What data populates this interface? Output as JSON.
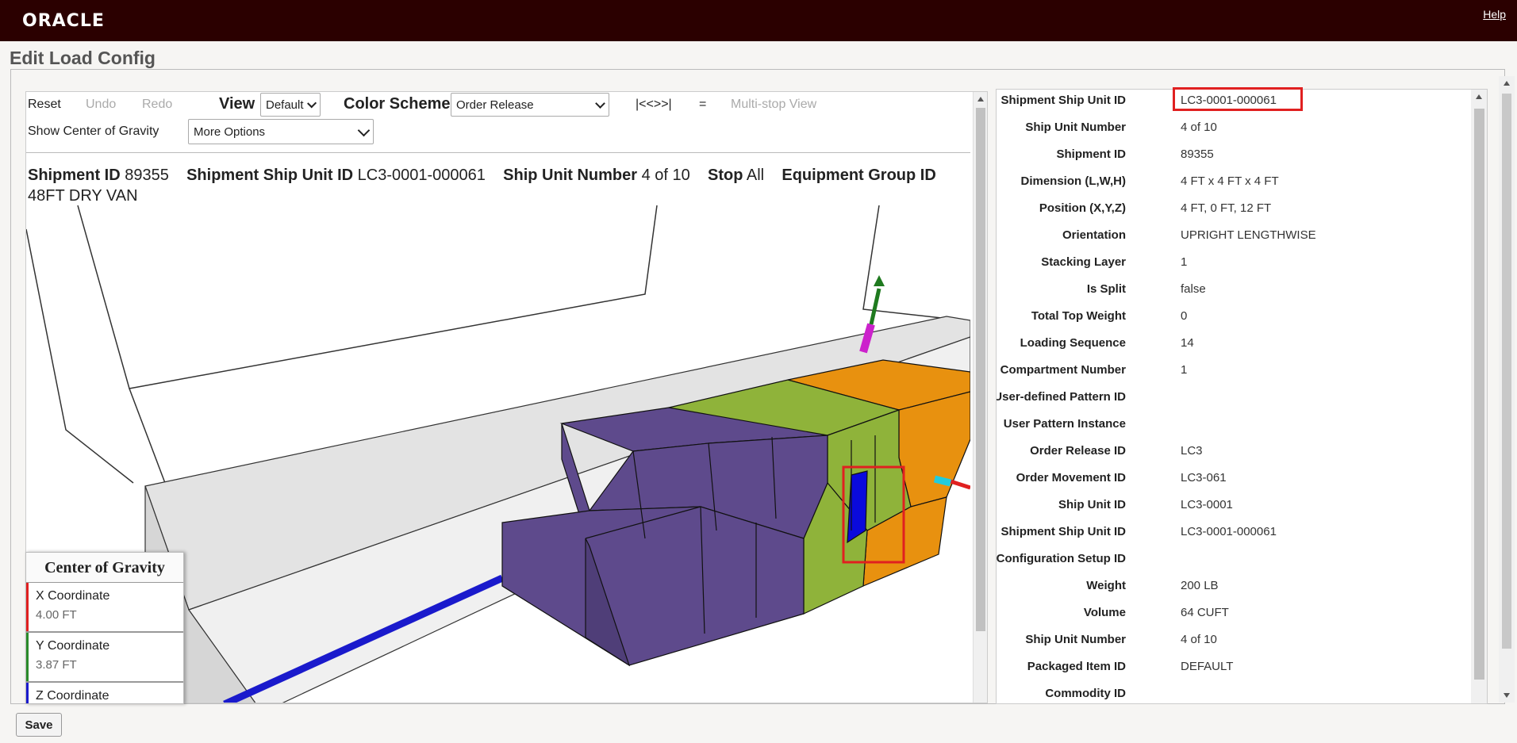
{
  "header": {
    "logo_text": "ORACLE",
    "help_label": "Help"
  },
  "page": {
    "title": "Edit Load Config"
  },
  "toolbar": {
    "reset_label": "Reset",
    "undo_label": "Undo",
    "redo_label": "Redo",
    "view_label": "View",
    "view_value": "Default",
    "color_scheme_label": "Color Scheme",
    "color_scheme_value": "Order Release",
    "nav_label": "|<<>>|",
    "equals_label": "=",
    "multistop_label": "Multi-stop View",
    "show_cog_label": "Show Center of Gravity",
    "more_options_label": "More Options"
  },
  "info": {
    "shipment_id_label": "Shipment ID",
    "shipment_id": "89355",
    "ssu_id_label": "Shipment Ship Unit ID",
    "ssu_id": "LC3-0001-000061",
    "ship_unit_number_label": "Ship Unit Number",
    "ship_unit_number": "4 of 10",
    "stop_label": "Stop",
    "stop": "All",
    "equipment_group_label": "Equipment Group ID",
    "equipment_group": "48FT DRY VAN"
  },
  "center_of_gravity": {
    "title": "Center of Gravity",
    "items": [
      {
        "label": "X Coordinate",
        "value": "4.00 FT",
        "color": "#e02020"
      },
      {
        "label": "Y Coordinate",
        "value": "3.87 FT",
        "color": "#2a8a2a"
      },
      {
        "label": "Z Coordinate",
        "value": "",
        "color": "#1a1acc"
      }
    ]
  },
  "scene": {
    "colors": {
      "purple": "#5e4a8c",
      "green": "#8fb33a",
      "orange": "#e8910f",
      "blue": "#0a0adc",
      "highlight": "#e02020"
    }
  },
  "properties": [
    {
      "key": "Shipment Ship Unit ID",
      "value": "LC3-0001-000061"
    },
    {
      "key": "Ship Unit Number",
      "value": "4 of 10"
    },
    {
      "key": "Shipment ID",
      "value": "89355"
    },
    {
      "key": "Dimension (L,W,H)",
      "value": "4 FT x 4 FT x 4 FT"
    },
    {
      "key": "Position (X,Y,Z)",
      "value": "4 FT, 0 FT, 12 FT"
    },
    {
      "key": "Orientation",
      "value": "UPRIGHT LENGTHWISE"
    },
    {
      "key": "Stacking Layer",
      "value": "1"
    },
    {
      "key": "Is Split",
      "value": "false"
    },
    {
      "key": "Total Top Weight",
      "value": "0"
    },
    {
      "key": "Loading Sequence",
      "value": "14"
    },
    {
      "key": "Compartment Number",
      "value": "1"
    },
    {
      "key": "User-defined Pattern ID",
      "value": ""
    },
    {
      "key": "User Pattern Instance",
      "value": ""
    },
    {
      "key": "Order Release ID",
      "value": "LC3"
    },
    {
      "key": "Order Movement ID",
      "value": "LC3-061"
    },
    {
      "key": "Ship Unit ID",
      "value": "LC3-0001"
    },
    {
      "key": "Shipment Ship Unit ID",
      "value": "LC3-0001-000061"
    },
    {
      "key": "Load Configuration Setup ID",
      "value": ""
    },
    {
      "key": "Weight",
      "value": "200 LB"
    },
    {
      "key": "Volume",
      "value": "64 CUFT"
    },
    {
      "key": "Ship Unit Number",
      "value": "4 of 10"
    },
    {
      "key": "Packaged Item ID",
      "value": "DEFAULT"
    },
    {
      "key": "Commodity ID",
      "value": ""
    }
  ],
  "footer": {
    "save_label": "Save"
  }
}
